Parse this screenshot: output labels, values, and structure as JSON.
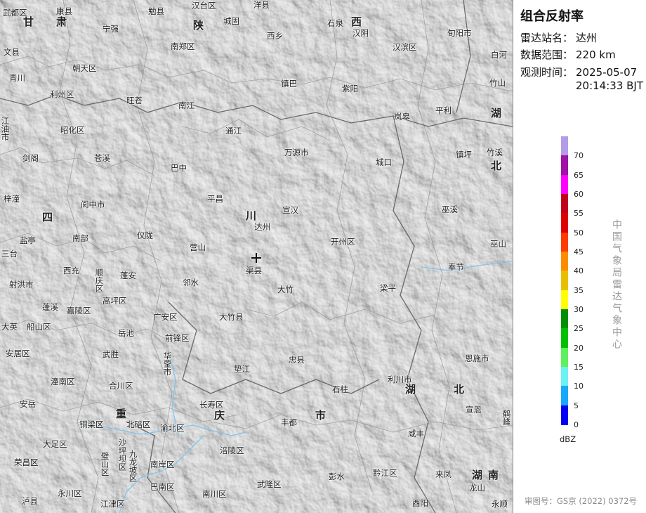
{
  "title": "组合反射率",
  "station": {
    "label": "雷达站名：",
    "value": "达州"
  },
  "range": {
    "label": "数据范围：",
    "value": "220 km"
  },
  "time": {
    "label": "观测时间：",
    "date": "2025-05-07",
    "clock": "20:14:33 BJT"
  },
  "legend": {
    "unit": "dBZ",
    "levels": [
      {
        "label": "70",
        "color": "#b39be6"
      },
      {
        "label": "65",
        "color": "#9f14a6"
      },
      {
        "label": "60",
        "color": "#ff00ff"
      },
      {
        "label": "55",
        "color": "#c1001c"
      },
      {
        "label": "50",
        "color": "#e00000"
      },
      {
        "label": "45",
        "color": "#ff3b00"
      },
      {
        "label": "40",
        "color": "#ff8c00"
      },
      {
        "label": "35",
        "color": "#e7c100"
      },
      {
        "label": "30",
        "color": "#ffff00"
      },
      {
        "label": "25",
        "color": "#009000"
      },
      {
        "label": "20",
        "color": "#00c000"
      },
      {
        "label": "15",
        "color": "#5ff05f"
      },
      {
        "label": "10",
        "color": "#6cf2f2"
      },
      {
        "label": "5",
        "color": "#1aa8ff"
      },
      {
        "label": "0",
        "color": "#0000f6"
      }
    ]
  },
  "agency": "中国气象局雷达气象中心",
  "review_no": "审图号：GS京 (2022) 0372号",
  "map": {
    "provinces": [
      "甘",
      "肃",
      "陕",
      "西",
      "湖",
      "北",
      "四",
      "川",
      "重",
      "庆",
      "市",
      "湖",
      "北",
      "湖",
      "南"
    ],
    "places": [
      "武都区",
      "康县",
      "勉县",
      "汉台区",
      "洋县",
      "城固",
      "宁强",
      "石泉",
      "汉阴",
      "旬阳市",
      "文县",
      "南郑区",
      "西乡",
      "汉滨区",
      "白河",
      "青川",
      "朝天区",
      "镇巴",
      "紫阳",
      "竹山",
      "利州区",
      "旺苍",
      "南江",
      "岚皋",
      "平利",
      "昭化区",
      "通江",
      "江油市",
      "剑阁",
      "苍溪",
      "巴中",
      "万源市",
      "镇坪",
      "竹溪",
      "城口",
      "梓潼",
      "平昌",
      "宣汉",
      "巫溪",
      "阆中市",
      "达州",
      "开州区",
      "巫山",
      "盐亭",
      "南部",
      "仪陇",
      "营山",
      "渠县",
      "奉节",
      "西充",
      "射洪市",
      "蓬安",
      "顺庆区",
      "大竹",
      "梁平",
      "蓬溪",
      "高坪区",
      "邻水",
      "垫江",
      "忠县",
      "嘉陵区",
      "广安区",
      "大竹县",
      "石柱",
      "船山区",
      "岳池",
      "前锋区",
      "大英",
      "武胜",
      "华蓥市",
      "长寿区",
      "利川市",
      "安居区",
      "潼南区",
      "合川区",
      "丰都",
      "恩施市",
      "安岳",
      "铜梁区",
      "北碚区",
      "渝北区",
      "涪陵区",
      "宣恩",
      "大足区",
      "沙坪坝区",
      "九龙坡区",
      "南岸区",
      "巴南区",
      "武隆区",
      "咸丰",
      "荣昌区",
      "璧山区",
      "永川区",
      "江津区",
      "彭水",
      "黔江区",
      "来凤",
      "泸县",
      "南川区",
      "酉阳",
      "龙山",
      "永顺",
      "三台",
      "鹤峰"
    ]
  }
}
